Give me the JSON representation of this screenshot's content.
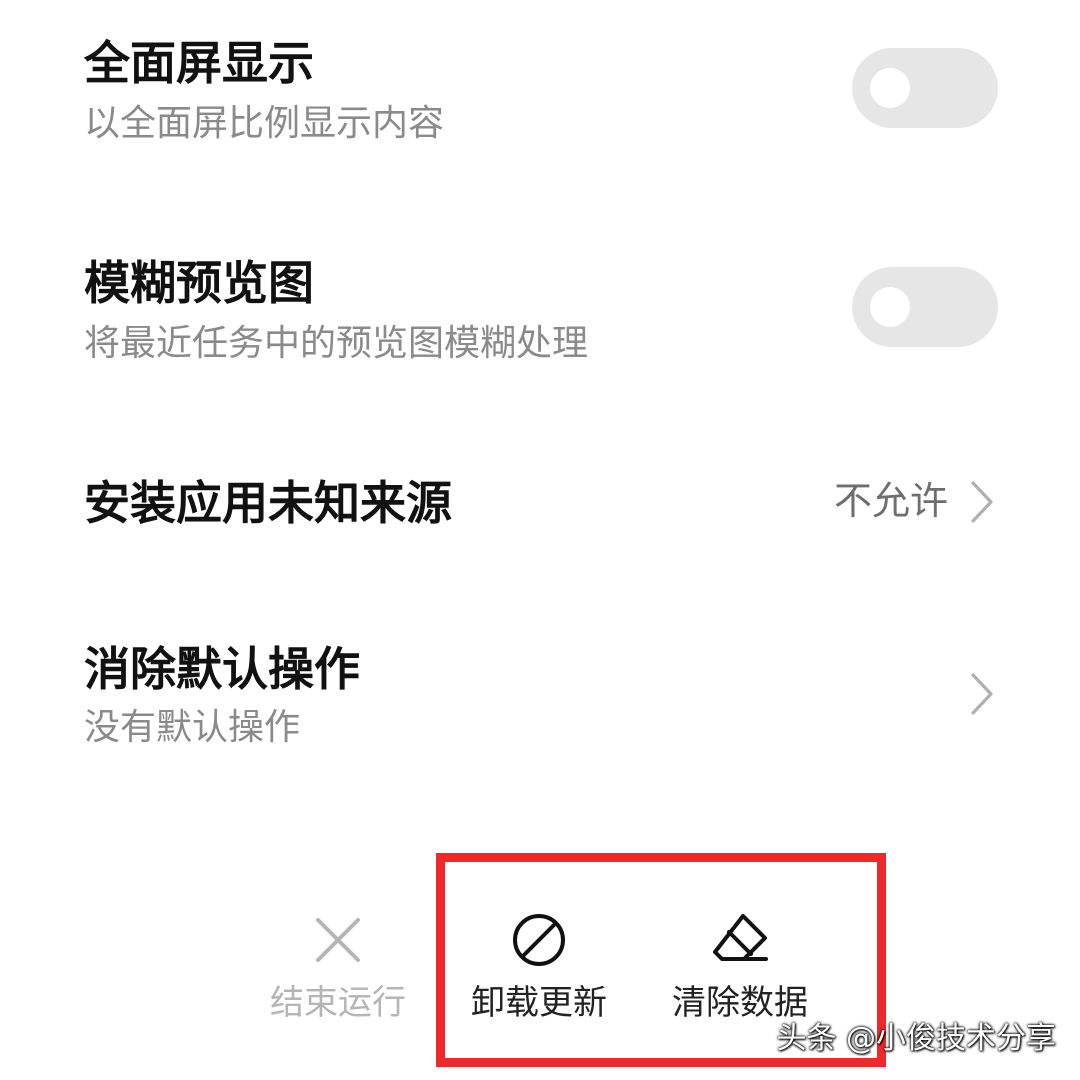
{
  "settings": {
    "full_screen": {
      "title": "全面屏显示",
      "subtitle": "以全面屏比例显示内容",
      "toggle_on": false
    },
    "blur_preview": {
      "title": "模糊预览图",
      "subtitle": "将最近任务中的预览图模糊处理",
      "toggle_on": false
    },
    "unknown_sources": {
      "title": "安装应用未知来源",
      "value": "不允许"
    },
    "clear_defaults": {
      "title": "消除默认操作",
      "subtitle": "没有默认操作"
    }
  },
  "actions": {
    "stop": {
      "label": "结束运行",
      "icon": "close-icon",
      "enabled": false
    },
    "uninstall_updates": {
      "label": "卸载更新",
      "icon": "prohibited-icon",
      "enabled": true
    },
    "clear_data": {
      "label": "清除数据",
      "icon": "eraser-icon",
      "enabled": true
    }
  },
  "highlight_color": "#f0282a",
  "watermark": "头条 @小俊技术分享"
}
